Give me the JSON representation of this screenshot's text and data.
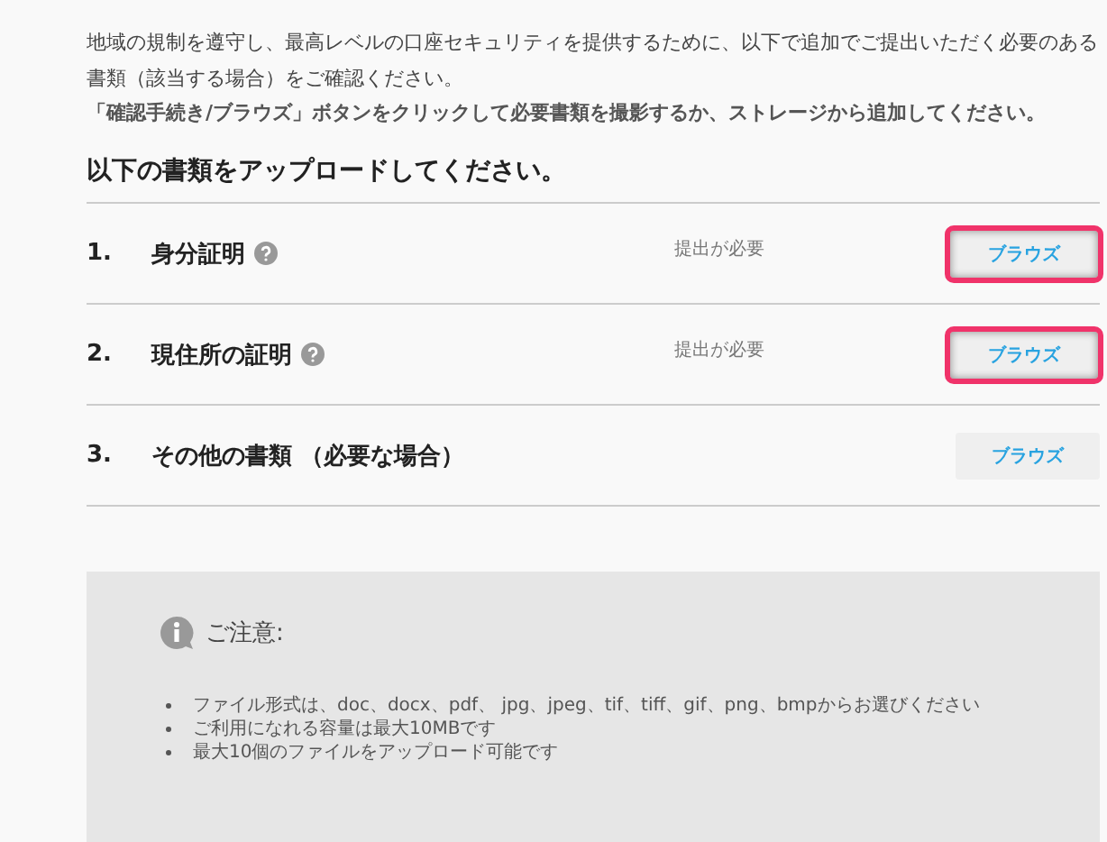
{
  "intro": {
    "text": "地域の規制を遵守し、最高レベルの口座セキュリティを提供するために、以下で追加でご提出いただく必要のある書類（該当する場合）をご確認ください。",
    "instruction": "「確認手続き/ブラウズ」ボタンをクリックして必要書類を撮影するか、ストレージから追加してください。"
  },
  "heading": "以下の書類をアップロードしてください。",
  "documents": [
    {
      "number": "1.",
      "title": "身分証明",
      "help": true,
      "status": "提出が必要",
      "button": "ブラウズ",
      "highlighted": true
    },
    {
      "number": "2.",
      "title": "現住所の証明",
      "help": true,
      "status": "提出が必要",
      "button": "ブラウズ",
      "highlighted": true
    },
    {
      "number": "3.",
      "title": "その他の書類 （必要な場合）",
      "help": false,
      "button": "ブラウズ",
      "highlighted": false
    }
  ],
  "notice": {
    "title": "ご注意:",
    "items": [
      "ファイル形式は、doc、docx、pdf、 jpg、jpeg、tif、tiff、gif、png、bmpからお選びください",
      "ご利用になれる容量は最大10MBです",
      "最大10個のファイルをアップロード可能です"
    ]
  }
}
